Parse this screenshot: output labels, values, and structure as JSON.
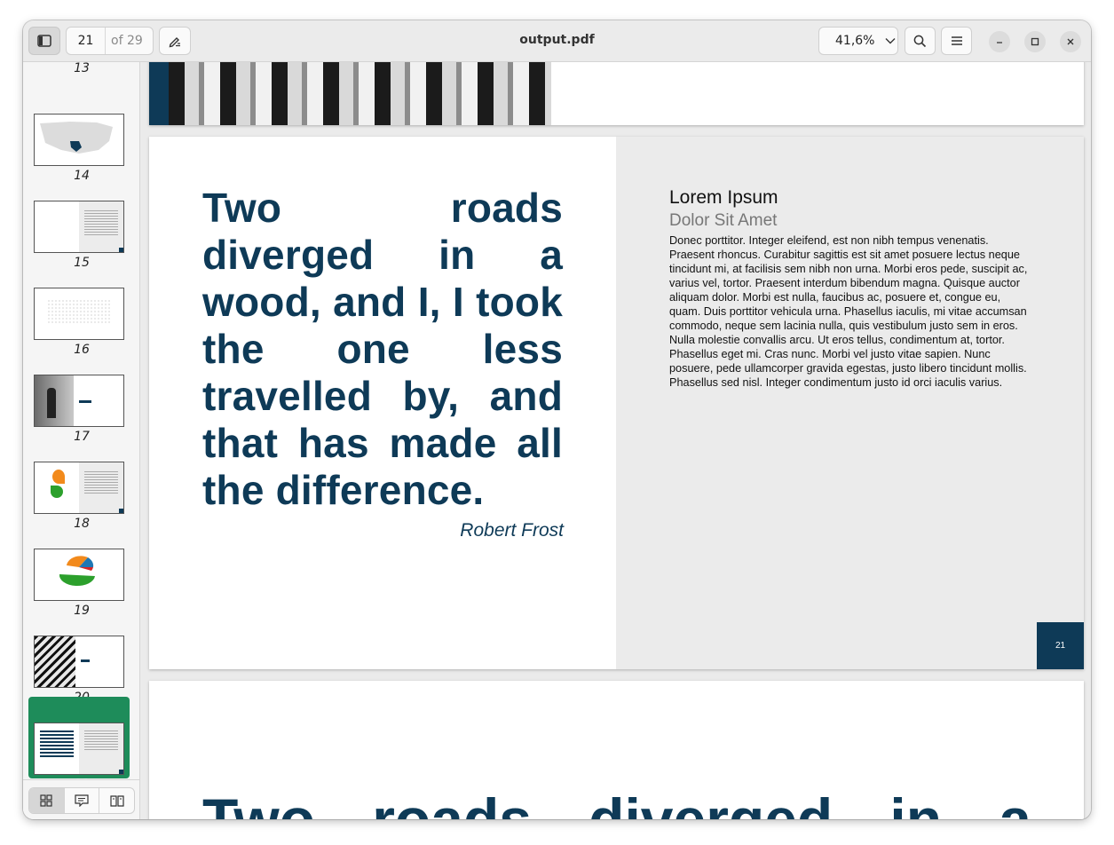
{
  "window": {
    "title": "output.pdf"
  },
  "toolbar": {
    "current_page": "21",
    "page_total": "of 29",
    "zoom": "41,6%"
  },
  "sidebar": {
    "top_partial_number": "13",
    "thumbnails": [
      {
        "number": "14"
      },
      {
        "number": "15"
      },
      {
        "number": "16"
      },
      {
        "number": "17"
      },
      {
        "number": "18"
      },
      {
        "number": "19"
      },
      {
        "number": "20"
      },
      {
        "number": "21",
        "selected": true
      }
    ],
    "selected_color": "#1e8c5a"
  },
  "page": {
    "quote_words": [
      "Two roads diverged in a wood, and I, I took the one less travelled by, and that has made all the difference."
    ],
    "quote": "Two roads diverged in a wood, and I, I took the one less travelled by, and that has made all the difference.",
    "author": "Robert Frost",
    "heading": "Lorem Ipsum",
    "subheading": "Dolor Sit Amet",
    "body": "Donec porttitor. Integer eleifend, est non nibh tempus venenatis. Praesent rhoncus. Curabitur sagittis est sit amet posuere lectus neque tincidunt mi, at facilisis sem nibh non urna. Morbi eros pede, suscipit ac, varius vel, tortor. Praesent interdum bibendum magna. Quisque auctor aliquam dolor. Morbi est nulla, faucibus ac, posuere et, congue eu, quam. Duis porttitor vehicula urna. Phasellus iaculis, mi vitae accumsan commodo, neque sem lacinia nulla, quis vestibulum justo sem in eros. Nulla molestie convallis arcu. Ut eros tellus, condimentum at, tortor. Phasellus eget mi. Cras nunc. Morbi vel justo vitae sapien. Nunc posuere, pede ullamcorper gravida egestas, justo libero tincidunt mollis. Phasellus sed nisl. Integer condimentum justo id orci iaculis varius.",
    "page_number": "21",
    "accent_color": "#0e3a57"
  },
  "next_page": {
    "words": [
      "Two",
      "roads",
      "diverged",
      "in",
      "a"
    ]
  },
  "icons": {
    "sidebar_toggle": "sidebar-icon",
    "annotate": "pen-icon",
    "search": "search-icon",
    "menu": "hamburger-icon",
    "minimize": "minimize-icon",
    "maximize": "maximize-icon",
    "close": "close-icon"
  }
}
